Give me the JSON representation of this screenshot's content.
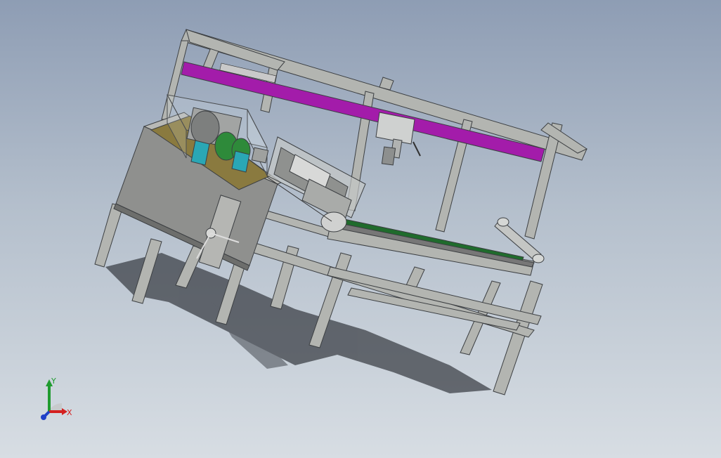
{
  "viewport": {
    "background_top": "#8e9db4",
    "background_bottom": "#d7dde3"
  },
  "model": {
    "frame_color": "#b3b5b1",
    "frame_edge_color": "#3c3f42",
    "accent_beam_color": "#a31caa",
    "conveyor_belt_color": "#1f6b2c",
    "housing_color": "#9b9c99",
    "wheel_color": "#2e8a3a",
    "bracket_color": "#2aa7b5",
    "plate_color": "#8a7a3f"
  },
  "triad": {
    "x_label": "X",
    "y_label": "Y",
    "x_color": "#d42020",
    "y_color": "#1f9b2f",
    "z_color": "#2040c8"
  }
}
